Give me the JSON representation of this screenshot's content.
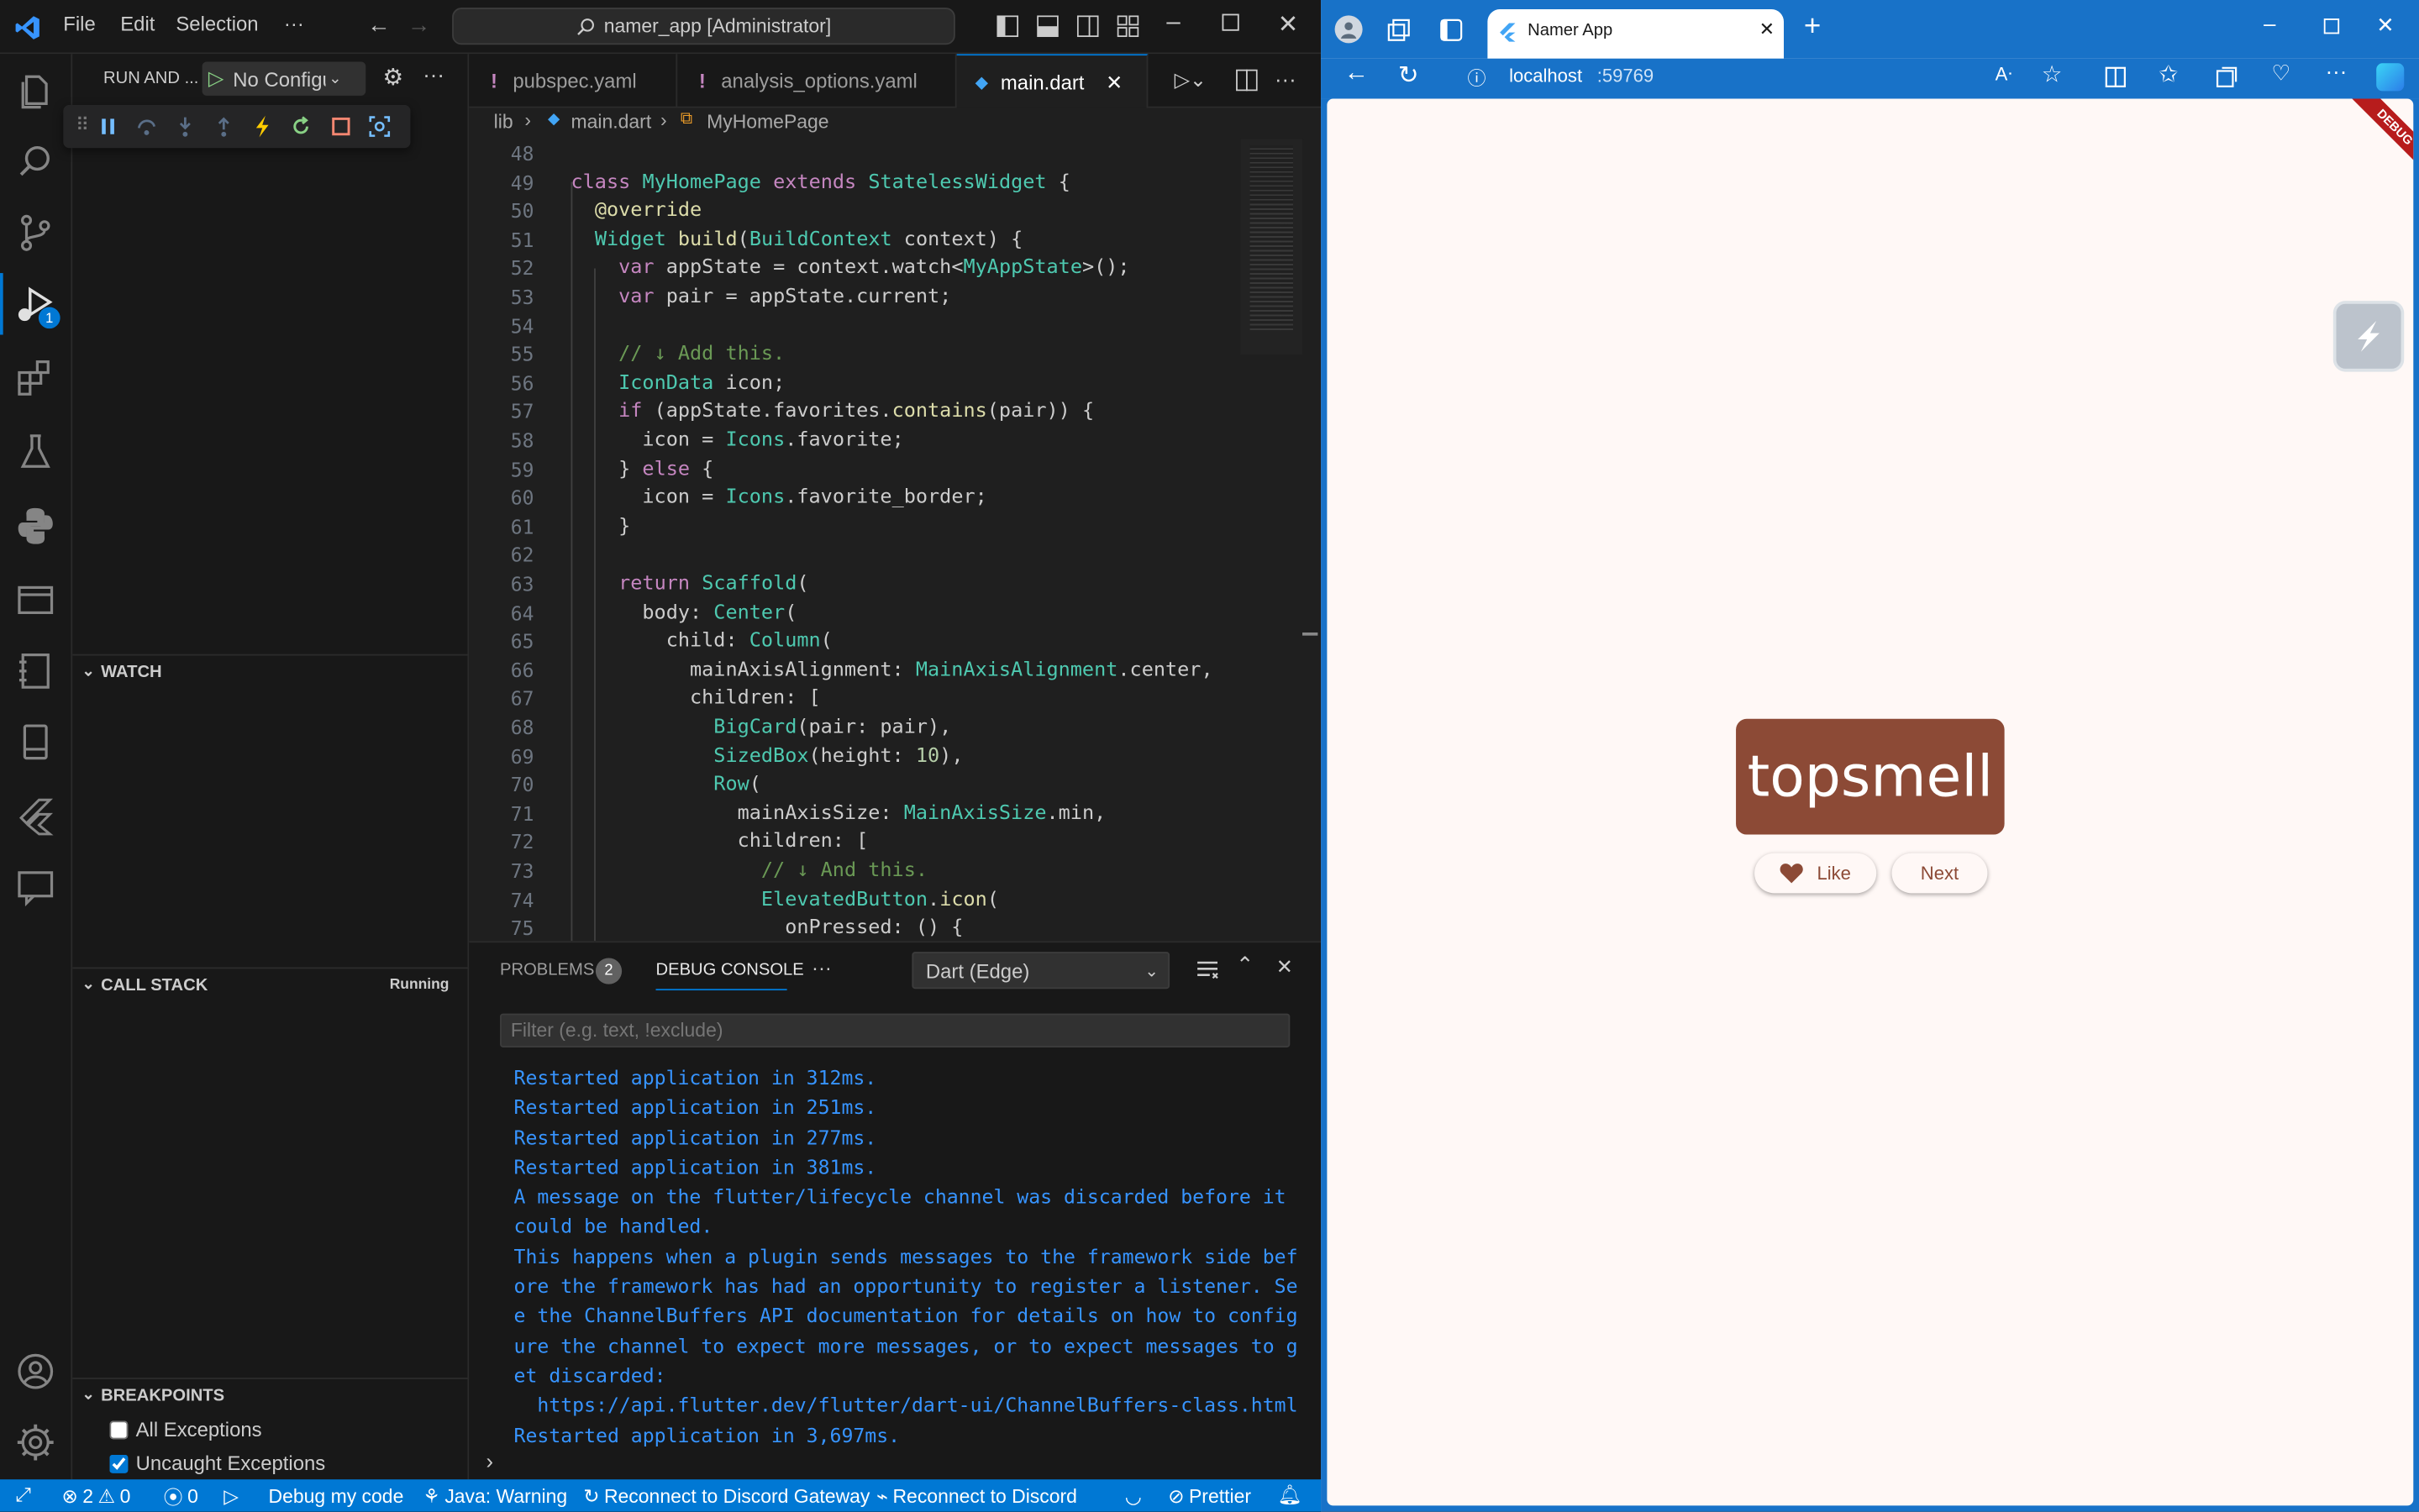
{
  "vscode": {
    "menu": [
      "File",
      "Edit",
      "Selection",
      "···"
    ],
    "command_center": "namer_app [Administrator]",
    "activity_badge": "1",
    "run_header": {
      "title": "RUN AND ...",
      "config": "No Configu"
    },
    "sections": {
      "watch": "WATCH",
      "call_stack": "CALL STACK",
      "call_stack_status": "Running",
      "breakpoints": "BREAKPOINTS"
    },
    "breakpoints": [
      {
        "label": "All Exceptions",
        "checked": false
      },
      {
        "label": "Uncaught Exceptions",
        "checked": true
      }
    ],
    "tabs": [
      {
        "label": "pubspec.yaml",
        "active": false
      },
      {
        "label": "analysis_options.yaml",
        "active": false
      },
      {
        "label": "main.dart",
        "active": true
      }
    ],
    "breadcrumb": [
      "lib",
      "main.dart",
      "MyHomePage"
    ],
    "code_lines": [
      {
        "n": "48",
        "text": ""
      },
      {
        "n": "49",
        "text": "class MyHomePage extends StatelessWidget {"
      },
      {
        "n": "50",
        "text": "  @override"
      },
      {
        "n": "51",
        "text": "  Widget build(BuildContext context) {"
      },
      {
        "n": "52",
        "text": "    var appState = context.watch<MyAppState>();"
      },
      {
        "n": "53",
        "text": "    var pair = appState.current;"
      },
      {
        "n": "54",
        "text": ""
      },
      {
        "n": "55",
        "text": "    // ↓ Add this."
      },
      {
        "n": "56",
        "text": "    IconData icon;"
      },
      {
        "n": "57",
        "text": "    if (appState.favorites.contains(pair)) {"
      },
      {
        "n": "58",
        "text": "      icon = Icons.favorite;"
      },
      {
        "n": "59",
        "text": "    } else {"
      },
      {
        "n": "60",
        "text": "      icon = Icons.favorite_border;"
      },
      {
        "n": "61",
        "text": "    }"
      },
      {
        "n": "62",
        "text": ""
      },
      {
        "n": "63",
        "text": "    return Scaffold("
      },
      {
        "n": "64",
        "text": "      body: Center("
      },
      {
        "n": "65",
        "text": "        child: Column("
      },
      {
        "n": "66",
        "text": "          mainAxisAlignment: MainAxisAlignment.center,"
      },
      {
        "n": "67",
        "text": "          children: ["
      },
      {
        "n": "68",
        "text": "            BigCard(pair: pair),"
      },
      {
        "n": "69",
        "text": "            SizedBox(height: 10),"
      },
      {
        "n": "70",
        "text": "            Row("
      },
      {
        "n": "71",
        "text": "              mainAxisSize: MainAxisSize.min,"
      },
      {
        "n": "72",
        "text": "              children: ["
      },
      {
        "n": "73",
        "text": "                // ↓ And this."
      },
      {
        "n": "74",
        "text": "                ElevatedButton.icon("
      },
      {
        "n": "75",
        "text": "                  onPressed: () {"
      }
    ],
    "panel": {
      "problems_label": "PROBLEMS",
      "problems_count": "2",
      "console_label": "DEBUG CONSOLE",
      "more": "···",
      "session": "Dart (Edge)",
      "filter_placeholder": "Filter (e.g. text, !exclude)",
      "output": [
        "Restarted application in 312ms.",
        "Restarted application in 251ms.",
        "Restarted application in 277ms.",
        "Restarted application in 381ms.",
        "A message on the flutter/lifecycle channel was discarded before it",
        "could be handled.",
        "This happens when a plugin sends messages to the framework side bef",
        "ore the framework has had an opportunity to register a listener. Se",
        "e the ChannelBuffers API documentation for details on how to config",
        "ure the channel to expect more messages, or to expect messages to g",
        "et discarded:",
        "  https://api.flutter.dev/flutter/dart-ui/ChannelBuffers-class.html",
        "Restarted application in 3,697ms."
      ]
    },
    "status": {
      "errors": "2",
      "warnings": "0",
      "ports": "0",
      "debug": "Debug my code",
      "java": "Java: Warning",
      "discord_gateway": "Reconnect to Discord Gateway",
      "discord": "Reconnect to Discord",
      "prettier": "Prettier"
    }
  },
  "browser": {
    "tab_title": "Namer App",
    "url_host": "localhost",
    "url_port": ":59769",
    "debug_banner": "DEBUG",
    "app": {
      "word": "topsmell",
      "like_label": "Like",
      "next_label": "Next",
      "card_color": "#8c4a36",
      "background": "#fff8f6"
    }
  }
}
